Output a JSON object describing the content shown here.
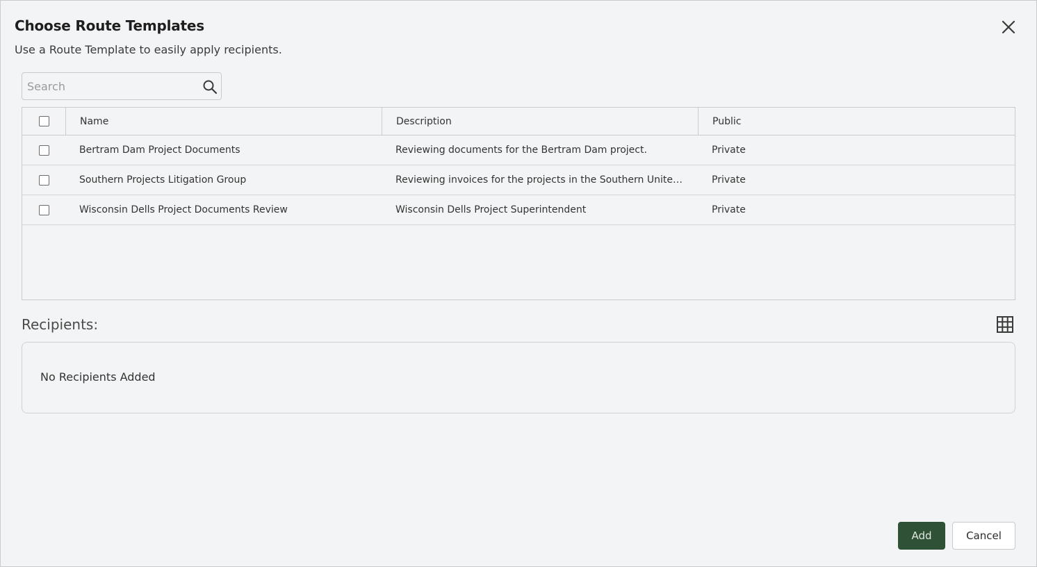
{
  "dialog": {
    "title": "Choose Route Templates",
    "subtitle": "Use a Route Template to easily apply recipients."
  },
  "search": {
    "placeholder": "Search",
    "value": ""
  },
  "table": {
    "columns": {
      "name": "Name",
      "description": "Description",
      "public": "Public"
    },
    "rows": [
      {
        "name": "Bertram Dam Project Documents",
        "description": "Reviewing documents for the Bertram Dam project.",
        "public": "Private"
      },
      {
        "name": "Southern Projects Litigation Group",
        "description": "Reviewing invoices for the projects in the Southern United…",
        "public": "Private"
      },
      {
        "name": "Wisconsin Dells Project Documents Review",
        "description": "Wisconsin Dells Project Superintendent",
        "public": "Private"
      }
    ]
  },
  "recipients": {
    "label": "Recipients:",
    "empty_text": "No Recipients Added"
  },
  "footer": {
    "add_label": "Add",
    "cancel_label": "Cancel"
  },
  "colors": {
    "primary_button": "#2f5236",
    "background": "#f3f4f5",
    "border": "#c9cbcd"
  },
  "icons": {
    "close": "close-icon",
    "search": "search-icon",
    "grid": "grid-icon"
  }
}
